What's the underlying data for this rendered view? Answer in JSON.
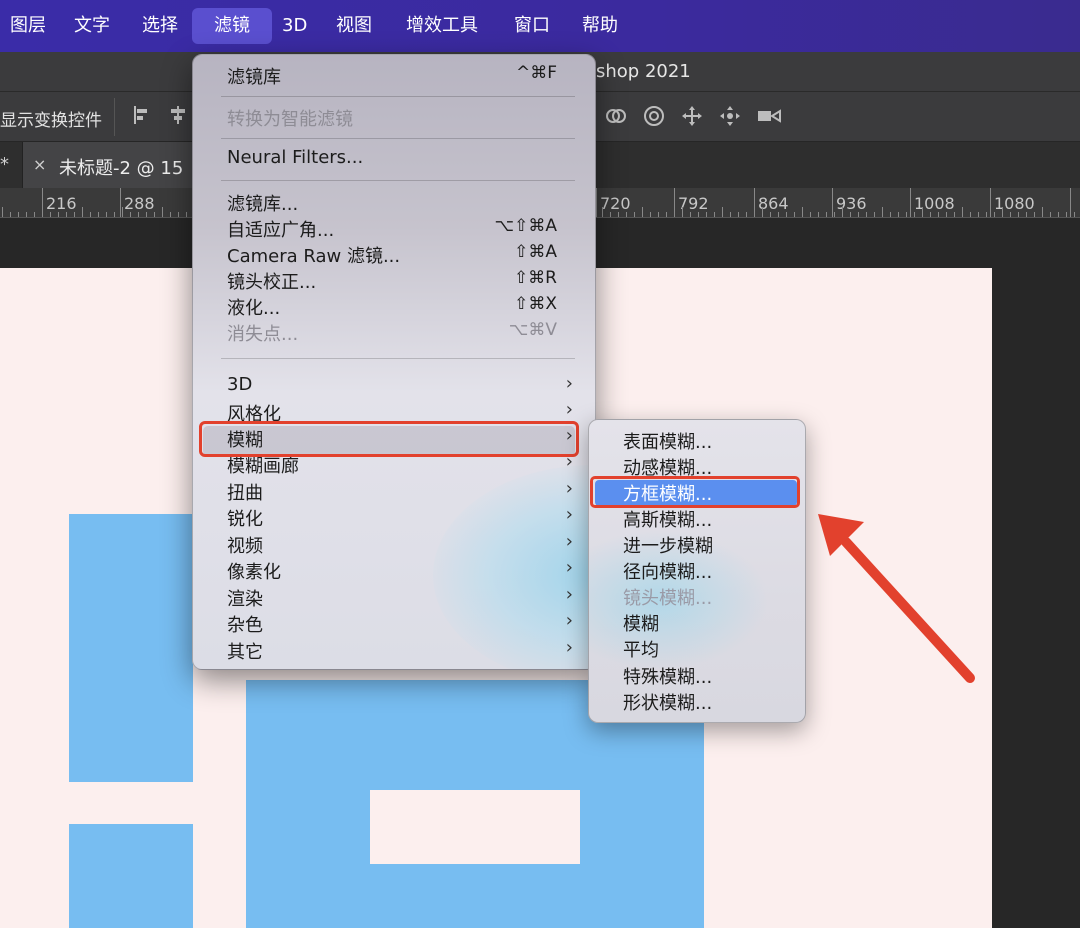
{
  "menubar": {
    "items": [
      "图层",
      "文字",
      "选择",
      "滤镜",
      "3D",
      "视图",
      "增效工具",
      "窗口",
      "帮助"
    ],
    "active": "滤镜"
  },
  "titlebar": {
    "title": "shop 2021"
  },
  "options": {
    "label": "显示变换控件"
  },
  "tabs": {
    "star": "*",
    "close": "×",
    "doc_name": "未标题-2 @ 15"
  },
  "ruler": {
    "labels": [
      "216",
      "288",
      "720",
      "792",
      "864",
      "936",
      "1008",
      "1080"
    ]
  },
  "filter_menu": {
    "items": [
      {
        "label": "滤镜库",
        "shortcut": "^⌘F",
        "disabled": false
      },
      {
        "label": "转换为智能滤镜",
        "shortcut": "",
        "disabled": true
      },
      {
        "label": "Neural Filters...",
        "shortcut": "",
        "disabled": false
      },
      {
        "label": "滤镜库...",
        "shortcut": "",
        "disabled": false
      },
      {
        "label": "自适应广角...",
        "shortcut": "⌥⇧⌘A",
        "disabled": false
      },
      {
        "label": "Camera Raw 滤镜...",
        "shortcut": "⇧⌘A",
        "disabled": false
      },
      {
        "label": "镜头校正...",
        "shortcut": "⇧⌘R",
        "disabled": false
      },
      {
        "label": "液化...",
        "shortcut": "⇧⌘X",
        "disabled": false
      },
      {
        "label": "消失点...",
        "shortcut": "⌥⌘V",
        "disabled": true
      },
      {
        "label": "3D",
        "submenu": true
      },
      {
        "label": "风格化",
        "submenu": true
      },
      {
        "label": "模糊",
        "submenu": true,
        "highlighted": true
      },
      {
        "label": "模糊画廊",
        "submenu": true
      },
      {
        "label": "扭曲",
        "submenu": true
      },
      {
        "label": "锐化",
        "submenu": true
      },
      {
        "label": "视频",
        "submenu": true
      },
      {
        "label": "像素化",
        "submenu": true
      },
      {
        "label": "渲染",
        "submenu": true
      },
      {
        "label": "杂色",
        "submenu": true
      },
      {
        "label": "其它",
        "submenu": true
      }
    ],
    "submenu_arrow": "›"
  },
  "blur_submenu": {
    "items": [
      {
        "label": "表面模糊...",
        "disabled": false
      },
      {
        "label": "动感模糊...",
        "disabled": false
      },
      {
        "label": "方框模糊...",
        "disabled": false,
        "selected": true
      },
      {
        "label": "高斯模糊...",
        "disabled": false
      },
      {
        "label": "进一步模糊",
        "disabled": false
      },
      {
        "label": "径向模糊...",
        "disabled": false
      },
      {
        "label": "镜头模糊...",
        "disabled": true
      },
      {
        "label": "模糊",
        "disabled": false
      },
      {
        "label": "平均",
        "disabled": false
      },
      {
        "label": "特殊模糊...",
        "disabled": false
      },
      {
        "label": "形状模糊...",
        "disabled": false
      }
    ]
  },
  "colors": {
    "menubar": "#3a2ca8",
    "highlight_blue": "#5b8fef",
    "annotation_red": "#e2412d",
    "canvas_bg": "#fcefee",
    "shape_blue": "#77bdf1"
  }
}
